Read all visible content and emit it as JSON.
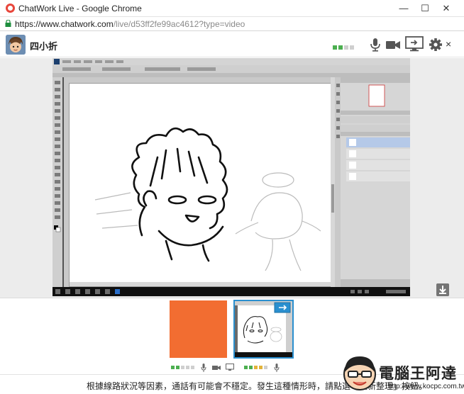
{
  "window": {
    "title": "ChatWork Live - Google Chrome",
    "min_glyph": "—",
    "max_glyph": "☐",
    "close_glyph": "✕"
  },
  "address": {
    "url_host": "https://www.chatwork.com",
    "url_path": "/live/d53ff2fe99ac4612?type=video"
  },
  "header": {
    "room_name": "四小折",
    "signal_level": 2,
    "signal_total": 4,
    "close_glyph": "×",
    "icons": [
      "microphone-icon",
      "camera-icon",
      "screen-share-icon",
      "gear-icon"
    ]
  },
  "thumbnails": [
    {
      "name": "orange-participant",
      "color": "#f26d31",
      "signal_level": 2,
      "signal_total": 5
    },
    {
      "name": "screen-participant",
      "color": "#2a8fcf",
      "signal_level": 2,
      "signal_total": 5
    }
  ],
  "footer": {
    "notice": "根據線路狀況等因素，通話有可能會不穩定。發生這種情形時，請點選「重新整理」按鈕。"
  },
  "watermark": {
    "text": "電腦王阿達",
    "url": "http://www.kocpc.com.tw"
  },
  "colors": {
    "signal_on": "#4caf50",
    "accent": "#2a8fcf",
    "orange_tile": "#f26d31",
    "brand_red": "#e8463b"
  }
}
